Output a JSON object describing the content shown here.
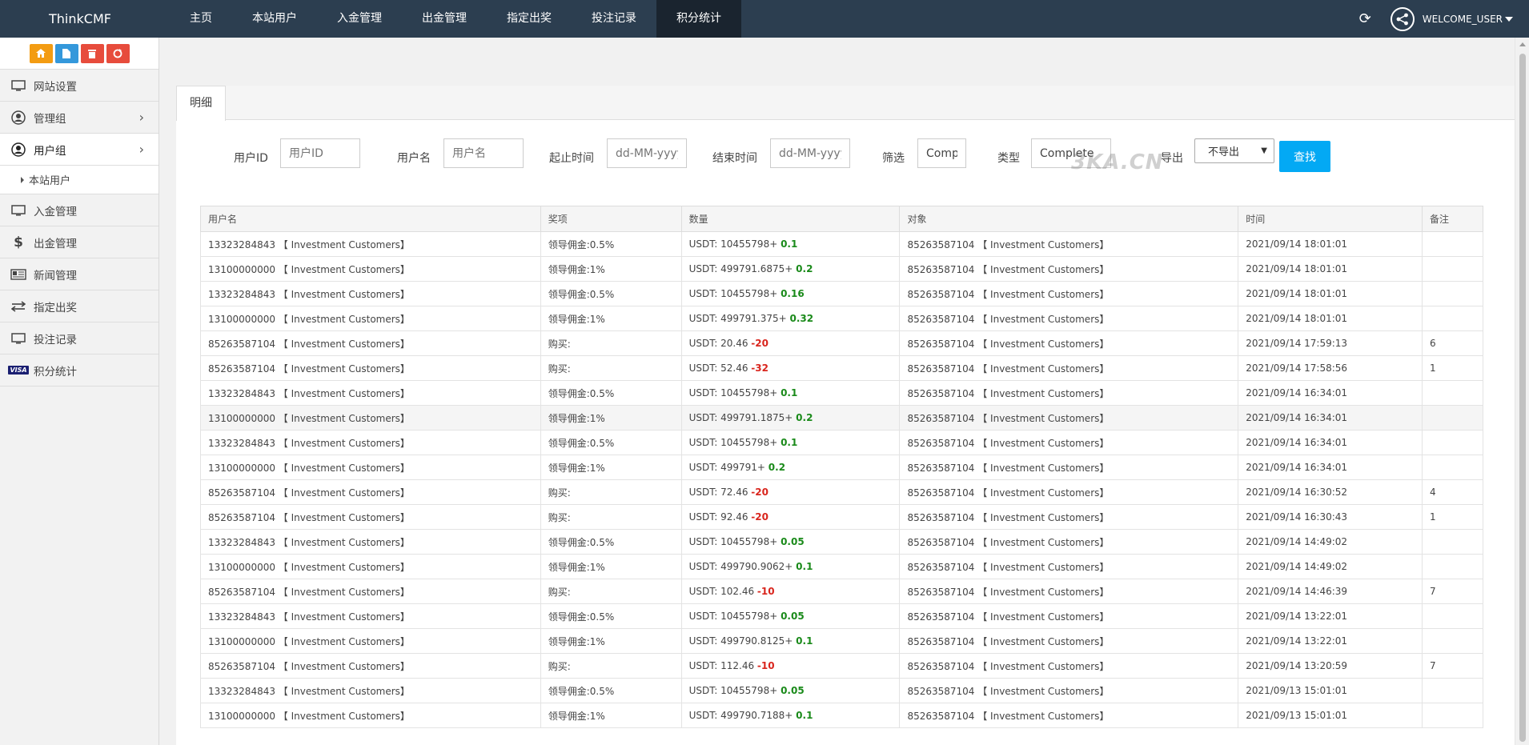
{
  "brand": "ThinkCMF",
  "top_nav": [
    {
      "label": "主页",
      "active": false
    },
    {
      "label": "本站用户",
      "active": false
    },
    {
      "label": "入金管理",
      "active": false
    },
    {
      "label": "出金管理",
      "active": false
    },
    {
      "label": "指定出奖",
      "active": false
    },
    {
      "label": "投注记录",
      "active": false
    },
    {
      "label": "积分统计",
      "active": true
    }
  ],
  "user": {
    "welcome": "WELCOME_USER"
  },
  "sidebar": {
    "items": [
      {
        "label": "网站设置",
        "icon": "monitor-icon"
      },
      {
        "label": "管理组",
        "icon": "user-circle-icon",
        "chevron": true
      },
      {
        "label": "用户组",
        "icon": "user-circle-icon",
        "chevron": true,
        "open": true
      },
      {
        "label": "入金管理",
        "icon": "monitor-icon"
      },
      {
        "label": "出金管理",
        "icon": "dollar-icon"
      },
      {
        "label": "新闻管理",
        "icon": "newspaper-icon"
      },
      {
        "label": "指定出奖",
        "icon": "exchange-icon"
      },
      {
        "label": "投注记录",
        "icon": "monitor-icon"
      },
      {
        "label": "积分统计",
        "icon": "visa-icon"
      }
    ],
    "subitem": "本站用户"
  },
  "tab": "明细",
  "filters": {
    "user_id_label": "用户ID",
    "user_id_placeholder": "用户ID",
    "username_label": "用户名",
    "username_placeholder": "用户名",
    "start_label": "起止时间",
    "start_placeholder": "dd-MM-yyyy",
    "end_label": "结束时间",
    "end_placeholder": "dd-MM-yyyy",
    "screen_label": "筛选",
    "screen_value": "Complete",
    "type_label": "类型",
    "type_value": "Complete",
    "export_label": "导出",
    "export_value": "不导出",
    "query_button": "查找"
  },
  "watermark": "3KA.CN",
  "table": {
    "headers": [
      "用户名",
      "奖项",
      "数量",
      "对象",
      "时间",
      "备注"
    ],
    "rows": [
      {
        "user": "13323284843 【 Investment Customers】",
        "award": "领导佣金:0.5%",
        "base": "USDT: 10455798+ ",
        "delta": "0.1",
        "sign": "pos",
        "target": "85263587104 【 Investment Customers】",
        "time": "2021/09/14 18:01:01",
        "note": ""
      },
      {
        "user": "13100000000 【 Investment Customers】",
        "award": "领导佣金:1%",
        "base": "USDT: 499791.6875+ ",
        "delta": "0.2",
        "sign": "pos",
        "target": "85263587104 【 Investment Customers】",
        "time": "2021/09/14 18:01:01",
        "note": ""
      },
      {
        "user": "13323284843 【 Investment Customers】",
        "award": "领导佣金:0.5%",
        "base": "USDT: 10455798+ ",
        "delta": "0.16",
        "sign": "pos",
        "target": "85263587104 【 Investment Customers】",
        "time": "2021/09/14 18:01:01",
        "note": ""
      },
      {
        "user": "13100000000 【 Investment Customers】",
        "award": "领导佣金:1%",
        "base": "USDT: 499791.375+ ",
        "delta": "0.32",
        "sign": "pos",
        "target": "85263587104 【 Investment Customers】",
        "time": "2021/09/14 18:01:01",
        "note": ""
      },
      {
        "user": "85263587104 【 Investment Customers】",
        "award": "购买:",
        "base": "USDT: 20.46 ",
        "delta": "-20",
        "sign": "neg",
        "target": "85263587104 【 Investment Customers】",
        "time": "2021/09/14 17:59:13",
        "note": "6"
      },
      {
        "user": "85263587104 【 Investment Customers】",
        "award": "购买:",
        "base": "USDT: 52.46 ",
        "delta": "-32",
        "sign": "neg",
        "target": "85263587104 【 Investment Customers】",
        "time": "2021/09/14 17:58:56",
        "note": "1"
      },
      {
        "user": "13323284843 【 Investment Customers】",
        "award": "领导佣金:0.5%",
        "base": "USDT: 10455798+ ",
        "delta": "0.1",
        "sign": "pos",
        "target": "85263587104 【 Investment Customers】",
        "time": "2021/09/14 16:34:01",
        "note": ""
      },
      {
        "user": "13100000000 【 Investment Customers】",
        "award": "领导佣金:1%",
        "base": "USDT: 499791.1875+ ",
        "delta": "0.2",
        "sign": "pos",
        "target": "85263587104 【 Investment Customers】",
        "time": "2021/09/14 16:34:01",
        "note": "",
        "highlight": true
      },
      {
        "user": "13323284843 【 Investment Customers】",
        "award": "领导佣金:0.5%",
        "base": "USDT: 10455798+ ",
        "delta": "0.1",
        "sign": "pos",
        "target": "85263587104 【 Investment Customers】",
        "time": "2021/09/14 16:34:01",
        "note": ""
      },
      {
        "user": "13100000000 【 Investment Customers】",
        "award": "领导佣金:1%",
        "base": "USDT: 499791+ ",
        "delta": "0.2",
        "sign": "pos",
        "target": "85263587104 【 Investment Customers】",
        "time": "2021/09/14 16:34:01",
        "note": ""
      },
      {
        "user": "85263587104 【 Investment Customers】",
        "award": "购买:",
        "base": "USDT: 72.46 ",
        "delta": "-20",
        "sign": "neg",
        "target": "85263587104 【 Investment Customers】",
        "time": "2021/09/14 16:30:52",
        "note": "4"
      },
      {
        "user": "85263587104 【 Investment Customers】",
        "award": "购买:",
        "base": "USDT: 92.46 ",
        "delta": "-20",
        "sign": "neg",
        "target": "85263587104 【 Investment Customers】",
        "time": "2021/09/14 16:30:43",
        "note": "1"
      },
      {
        "user": "13323284843 【 Investment Customers】",
        "award": "领导佣金:0.5%",
        "base": "USDT: 10455798+ ",
        "delta": "0.05",
        "sign": "pos",
        "target": "85263587104 【 Investment Customers】",
        "time": "2021/09/14 14:49:02",
        "note": ""
      },
      {
        "user": "13100000000 【 Investment Customers】",
        "award": "领导佣金:1%",
        "base": "USDT: 499790.9062+ ",
        "delta": "0.1",
        "sign": "pos",
        "target": "85263587104 【 Investment Customers】",
        "time": "2021/09/14 14:49:02",
        "note": ""
      },
      {
        "user": "85263587104 【 Investment Customers】",
        "award": "购买:",
        "base": "USDT: 102.46 ",
        "delta": "-10",
        "sign": "neg",
        "target": "85263587104 【 Investment Customers】",
        "time": "2021/09/14 14:46:39",
        "note": "7"
      },
      {
        "user": "13323284843 【 Investment Customers】",
        "award": "领导佣金:0.5%",
        "base": "USDT: 10455798+ ",
        "delta": "0.05",
        "sign": "pos",
        "target": "85263587104 【 Investment Customers】",
        "time": "2021/09/14 13:22:01",
        "note": ""
      },
      {
        "user": "13100000000 【 Investment Customers】",
        "award": "领导佣金:1%",
        "base": "USDT: 499790.8125+ ",
        "delta": "0.1",
        "sign": "pos",
        "target": "85263587104 【 Investment Customers】",
        "time": "2021/09/14 13:22:01",
        "note": ""
      },
      {
        "user": "85263587104 【 Investment Customers】",
        "award": "购买:",
        "base": "USDT: 112.46 ",
        "delta": "-10",
        "sign": "neg",
        "target": "85263587104 【 Investment Customers】",
        "time": "2021/09/14 13:20:59",
        "note": "7"
      },
      {
        "user": "13323284843 【 Investment Customers】",
        "award": "领导佣金:0.5%",
        "base": "USDT: 10455798+ ",
        "delta": "0.05",
        "sign": "pos",
        "target": "85263587104 【 Investment Customers】",
        "time": "2021/09/13 15:01:01",
        "note": ""
      },
      {
        "user": "13100000000 【 Investment Customers】",
        "award": "领导佣金:1%",
        "base": "USDT: 499790.7188+ ",
        "delta": "0.1",
        "sign": "pos",
        "target": "85263587104 【 Investment Customers】",
        "time": "2021/09/13 15:01:01",
        "note": ""
      }
    ]
  }
}
